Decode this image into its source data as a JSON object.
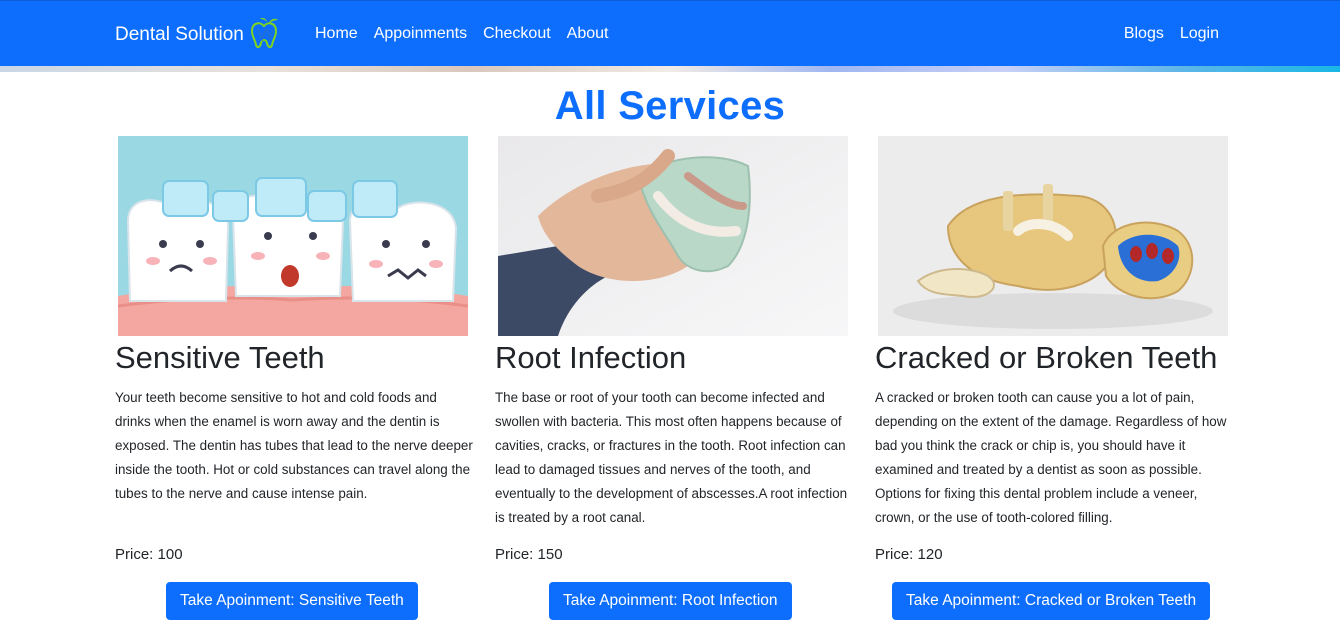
{
  "navbar": {
    "brand": "Dental Solution",
    "links": [
      "Home",
      "Appoinments",
      "Checkout",
      "About"
    ],
    "right_links": [
      "Blogs",
      "Login"
    ]
  },
  "page_title": "All Services",
  "services": [
    {
      "title": "Sensitive Teeth",
      "description": "Your teeth become sensitive to hot and cold foods and drinks when the enamel is worn away and the dentin is exposed. The dentin has tubes that lead to the nerve deeper inside the tooth. Hot or cold substances can travel along the tubes to the nerve and cause intense pain.",
      "price": "Price: 100",
      "button": "Take Apoinment: Sensitive Teeth"
    },
    {
      "title": "Root Infection",
      "description": "The base or root of your tooth can become infected and swollen with bacteria. This most often happens because of cavities, cracks, or fractures in the tooth. Root infection can lead to damaged tissues and nerves of the tooth, and eventually to the development of abscesses.A root infection is treated by a root canal.",
      "price": "Price: 150",
      "button": "Take Apoinment: Root Infection"
    },
    {
      "title": "Cracked or Broken Teeth",
      "description": "A cracked or broken tooth can cause you a lot of pain, depending on the extent of the damage. Regardless of how bad you think the crack or chip is, you should have it examined and treated by a dentist as soon as possible. Options for fixing this dental problem include a veneer, crown, or the use of tooth-colored filling.",
      "price": "Price: 120",
      "button": "Take Apoinment: Cracked or Broken Teeth"
    }
  ],
  "colors": {
    "primary": "#0d6efd",
    "text": "#212529",
    "background": "#ffffff"
  }
}
